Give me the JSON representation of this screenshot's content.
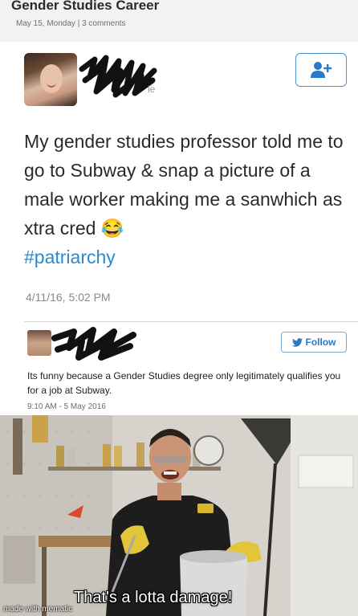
{
  "header": {
    "title": "Gender Studies Career",
    "meta": "May 15, Monday | 3 comments"
  },
  "tweet1": {
    "name_suffix": "ie",
    "text": "My gender studies professor told me to go to Subway & snap a picture of a male worker making me a sanwhich as xtra cred 😂",
    "hashtag": "#patriarchy",
    "timestamp": "4/11/16, 5:02 PM",
    "follow_icon": "add-user-icon"
  },
  "tweet2": {
    "follow_label": "Follow",
    "follow_icon": "twitter-bird-icon",
    "text": "Its funny because a Gender Studies degree only legitimately qualifies you for a job at Subway.",
    "timestamp": "9:10 AM - 5 May 2016"
  },
  "meme": {
    "caption": "That's a lotta damage!",
    "watermark": "made with mematic"
  },
  "colors": {
    "accent_blue": "#2a8ad0",
    "follow_border": "#4d8fd0"
  }
}
